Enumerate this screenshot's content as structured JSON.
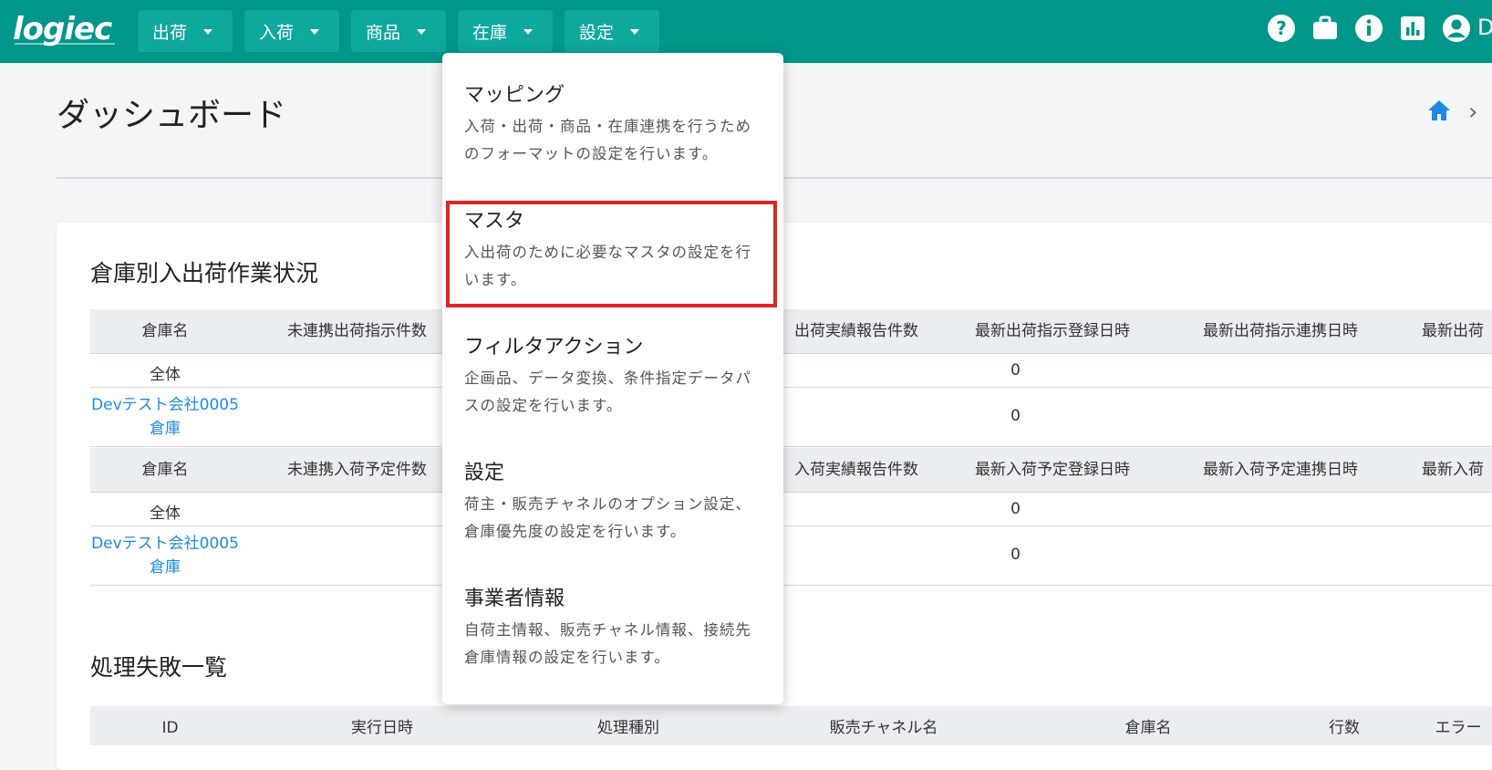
{
  "header": {
    "logo": "logiec",
    "nav": [
      {
        "label": "出荷"
      },
      {
        "label": "入荷"
      },
      {
        "label": "商品"
      },
      {
        "label": "在庫"
      },
      {
        "label": "設定"
      }
    ],
    "icons": [
      "help-icon",
      "briefcase-icon",
      "info-icon",
      "report-chart-icon",
      "account-icon"
    ],
    "user_initial": "D",
    "colors": {
      "bar": "#00968a",
      "button": "#0ea89c"
    }
  },
  "page": {
    "title": "ダッシュボード",
    "breadcrumb_separator": "›"
  },
  "warehouse_status": {
    "title": "倉庫別入出荷作業状況",
    "shipping": {
      "headers": [
        "倉庫名",
        "未連携出荷指示件数",
        "出荷実績報告件数",
        "最新出荷指示登録日時",
        "最新出荷指示連携日時",
        "最新出荷"
      ],
      "rows": [
        {
          "name": "全体",
          "count": "0"
        },
        {
          "name_line1": "Devテスト会社0005",
          "name_line2": "倉庫",
          "count": "0"
        }
      ]
    },
    "receiving": {
      "headers": [
        "倉庫名",
        "未連携入荷予定件数",
        "入荷実績報告件数",
        "最新入荷予定登録日時",
        "最新入荷予定連携日時",
        "最新入荷"
      ],
      "rows": [
        {
          "name": "全体",
          "count": "0"
        },
        {
          "name_line1": "Devテスト会社0005",
          "name_line2": "倉庫",
          "count": "0"
        }
      ]
    }
  },
  "failures": {
    "title": "処理失敗一覧",
    "headers": [
      "ID",
      "実行日時",
      "処理種別",
      "販売チャネル名",
      "倉庫名",
      "行数",
      "エラー"
    ]
  },
  "dropdown": {
    "items": [
      {
        "title": "マッピング",
        "desc1": "入荷・出荷・商品・在庫連携を行うため",
        "desc2": "のフォーマットの設定を行います。"
      },
      {
        "title": "マスタ",
        "desc1": "入出荷のために必要なマスタの設定を行",
        "desc2": "います。"
      },
      {
        "title": "フィルタアクション",
        "desc1": "企画品、データ変換、条件指定データパ",
        "desc2": "スの設定を行います。"
      },
      {
        "title": "設定",
        "desc1": "荷主・販売チャネルのオプション設定、",
        "desc2": "倉庫優先度の設定を行います。"
      },
      {
        "title": "事業者情報",
        "desc1": "自荷主情報、販売チャネル情報、接続先",
        "desc2": "倉庫情報の設定を行います。"
      }
    ],
    "highlight_color": "#e02424"
  }
}
